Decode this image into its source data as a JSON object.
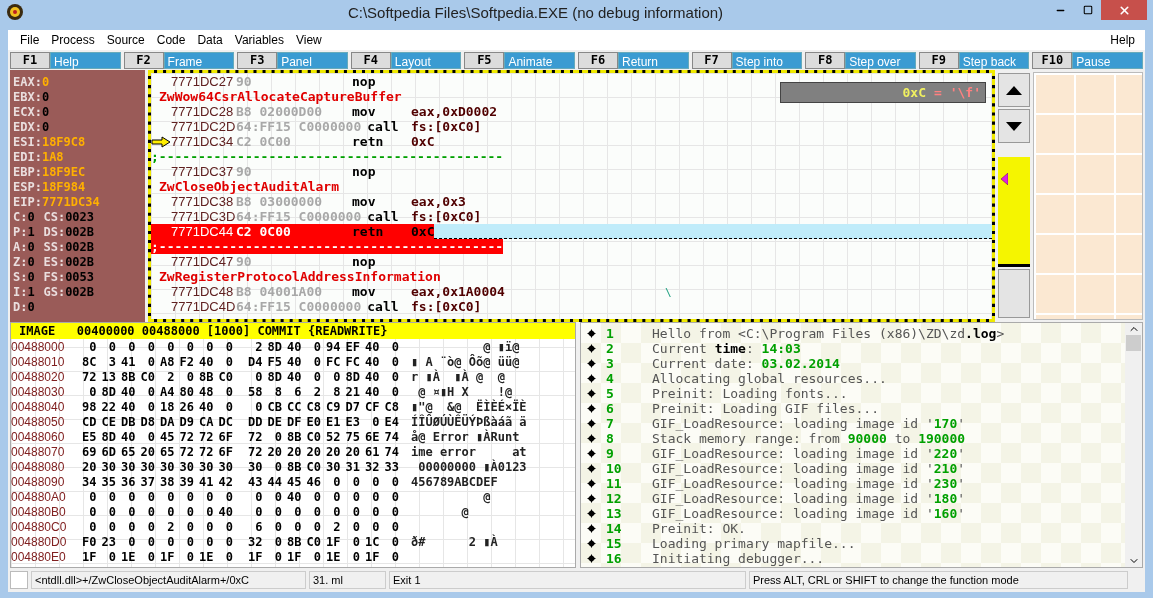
{
  "window": {
    "title": "C:\\Softpedia Files\\Softpedia.EXE (no debug information)"
  },
  "menu": {
    "items": [
      "File",
      "Process",
      "Source",
      "Code",
      "Data",
      "Variables",
      "View"
    ],
    "help": "Help"
  },
  "function_keys": [
    {
      "key": "F1",
      "action": "Help"
    },
    {
      "key": "F2",
      "action": "Frame"
    },
    {
      "key": "F3",
      "action": "Panel"
    },
    {
      "key": "F4",
      "action": "Layout"
    },
    {
      "key": "F5",
      "action": "Animate"
    },
    {
      "key": "F6",
      "action": "Return"
    },
    {
      "key": "F7",
      "action": "Step into"
    },
    {
      "key": "F8",
      "action": "Step over"
    },
    {
      "key": "F9",
      "action": "Step back"
    },
    {
      "key": "F10",
      "action": "Pause"
    }
  ],
  "registers": [
    {
      "name": "EAX:",
      "value": "0",
      "changed": true
    },
    {
      "name": "EBX:",
      "value": "0",
      "changed": false
    },
    {
      "name": "ECX:",
      "value": "0",
      "changed": false
    },
    {
      "name": "EDX:",
      "value": "0",
      "changed": false
    },
    {
      "name": "ESI:",
      "value": "18F9C8",
      "changed": true
    },
    {
      "name": "EDI:",
      "value": "1A8",
      "changed": true
    },
    {
      "name": "EBP:",
      "value": "18F9EC",
      "changed": true
    },
    {
      "name": "ESP:",
      "value": "18F984",
      "changed": true
    },
    {
      "name": "EIP:",
      "value": "7771DC34",
      "changed": true
    }
  ],
  "flags": [
    {
      "name": "C:",
      "value": "0"
    },
    {
      "name": "P:",
      "value": "1"
    },
    {
      "name": "A:",
      "value": "0"
    },
    {
      "name": "Z:",
      "value": "0"
    },
    {
      "name": "S:",
      "value": "0"
    },
    {
      "name": "I:",
      "value": "1"
    },
    {
      "name": "D:",
      "value": "0"
    }
  ],
  "segments": [
    {
      "name": "CS:",
      "value": "0023"
    },
    {
      "name": "DS:",
      "value": "002B"
    },
    {
      "name": "SS:",
      "value": "002B"
    },
    {
      "name": "ES:",
      "value": "002B"
    },
    {
      "name": "FS:",
      "value": "0053"
    },
    {
      "name": "GS:",
      "value": "002B"
    }
  ],
  "disassembly": {
    "tooltip": {
      "expr": "0xC",
      "value": "= '\\f'"
    },
    "marker": "\\",
    "rows": [
      {
        "kind": "instruction",
        "address": "7771DC27",
        "bytes": "90",
        "mnemonic": "nop",
        "current": false,
        "selected": false
      },
      {
        "kind": "label",
        "text": "ZwWow64CsrAllocateCaptureBuffer",
        "selected": false
      },
      {
        "kind": "instruction",
        "address": "7771DC28",
        "bytes": "B8 02000D00",
        "mnemonic": "mov",
        "operand": "eax,0xD0002",
        "current": false,
        "selected": false
      },
      {
        "kind": "instruction",
        "address": "7771DC2D",
        "bytes": "64:FF15 C0000000",
        "mnemonic": "call",
        "operand": "fs:[0xC0]",
        "current": false,
        "selected": false
      },
      {
        "kind": "instruction",
        "address": "7771DC34",
        "bytes": "C2 0C00",
        "mnemonic": "retn",
        "operand": "0xC",
        "current": true,
        "selected": false
      },
      {
        "kind": "separator",
        "text": ";--------------------------------------------",
        "selected": false
      },
      {
        "kind": "instruction",
        "address": "7771DC37",
        "bytes": "90",
        "mnemonic": "nop",
        "current": false,
        "selected": false
      },
      {
        "kind": "label",
        "text": "ZwCloseObjectAuditAlarm",
        "selected": false
      },
      {
        "kind": "instruction",
        "address": "7771DC38",
        "bytes": "B8 03000000",
        "mnemonic": "mov",
        "operand": "eax,0x3",
        "current": false,
        "selected": false
      },
      {
        "kind": "instruction",
        "address": "7771DC3D",
        "bytes": "64:FF15 C0000000",
        "mnemonic": "call",
        "operand": "fs:[0xC0]",
        "current": false,
        "selected": false
      },
      {
        "kind": "instruction",
        "address": "7771DC44",
        "bytes": "C2 0C00",
        "mnemonic": "retn",
        "operand": "0xC",
        "current": false,
        "selected": true
      },
      {
        "kind": "separator",
        "text": ";--------------------------------------------",
        "selected": true
      },
      {
        "kind": "instruction",
        "address": "7771DC47",
        "bytes": "90",
        "mnemonic": "nop",
        "current": false,
        "selected": false
      },
      {
        "kind": "label",
        "text": "ZwRegisterProtocolAddressInformation",
        "selected": false
      },
      {
        "kind": "instruction",
        "address": "7771DC48",
        "bytes": "B8 04001A00",
        "mnemonic": "mov",
        "operand": "eax,0x1A0004",
        "current": false,
        "selected": false
      },
      {
        "kind": "instruction",
        "address": "7771DC4D",
        "bytes": "64:FF15 C0000000",
        "mnemonic": "call",
        "operand": "fs:[0xC0]",
        "current": false,
        "selected": false
      }
    ]
  },
  "memory": {
    "header": "IMAGE   00400000 00488000 [1000] COMMIT {READWRITE}",
    "rows": [
      {
        "address": "00488000",
        "bytes": [
          "0",
          "0",
          "0",
          "0",
          "0",
          "0",
          "0",
          "0",
          "2",
          "8D",
          "40",
          "0",
          "94",
          "EF",
          "40",
          "0"
        ],
        "ascii": "          @ ▮ï@"
      },
      {
        "address": "00488010",
        "bytes": [
          "8C",
          "3",
          "41",
          "0",
          "A8",
          "F2",
          "40",
          "0",
          "D4",
          "F5",
          "40",
          "0",
          "FC",
          "FC",
          "40",
          "0"
        ],
        "ascii": "▮ A ¨ò@ Ôõ@ üü@"
      },
      {
        "address": "00488020",
        "bytes": [
          "72",
          "13",
          "8B",
          "C0",
          "2",
          "0",
          "8B",
          "C0",
          "0",
          "8D",
          "40",
          "0",
          "0",
          "8D",
          "40",
          "0"
        ],
        "ascii": "r ▮À  ▮À @  @"
      },
      {
        "address": "00488030",
        "bytes": [
          "0",
          "8D",
          "40",
          "0",
          "A4",
          "80",
          "48",
          "0",
          "58",
          "8",
          "6",
          "2",
          "8",
          "21",
          "40",
          "0"
        ],
        "ascii": " @ ¤▮H X    !@"
      },
      {
        "address": "00488040",
        "bytes": [
          "98",
          "22",
          "40",
          "0",
          "18",
          "26",
          "40",
          "0",
          "0",
          "CB",
          "CC",
          "C8",
          "C9",
          "D7",
          "CF",
          "C8"
        ],
        "ascii": "▮\"@  &@  ËÌÈÉ×ÏÈ"
      },
      {
        "address": "00488050",
        "bytes": [
          "CD",
          "CE",
          "DB",
          "D8",
          "DA",
          "D9",
          "CA",
          "DC",
          "DD",
          "DE",
          "DF",
          "E0",
          "E1",
          "E3",
          "0",
          "E4"
        ],
        "ascii": "ÍÎÛØÚÙÊÜÝÞßàáã ä"
      },
      {
        "address": "00488060",
        "bytes": [
          "E5",
          "8D",
          "40",
          "0",
          "45",
          "72",
          "72",
          "6F",
          "72",
          "0",
          "8B",
          "C0",
          "52",
          "75",
          "6E",
          "74"
        ],
        "ascii": "å@ Error ▮ÀRunt"
      },
      {
        "address": "00488070",
        "bytes": [
          "69",
          "6D",
          "65",
          "20",
          "65",
          "72",
          "72",
          "6F",
          "72",
          "20",
          "20",
          "20",
          "20",
          "20",
          "61",
          "74"
        ],
        "ascii": "ime error     at"
      },
      {
        "address": "00488080",
        "bytes": [
          "20",
          "30",
          "30",
          "30",
          "30",
          "30",
          "30",
          "30",
          "30",
          "0",
          "8B",
          "C0",
          "30",
          "31",
          "32",
          "33"
        ],
        "ascii": " 00000000 ▮À0123"
      },
      {
        "address": "00488090",
        "bytes": [
          "34",
          "35",
          "36",
          "37",
          "38",
          "39",
          "41",
          "42",
          "43",
          "44",
          "45",
          "46",
          "0",
          "0",
          "0",
          "0"
        ],
        "ascii": "456789ABCDEF"
      },
      {
        "address": "004880A0",
        "bytes": [
          "0",
          "0",
          "0",
          "0",
          "0",
          "0",
          "0",
          "0",
          "0",
          "0",
          "40",
          "0",
          "0",
          "0",
          "0",
          "0"
        ],
        "ascii": "          @"
      },
      {
        "address": "004880B0",
        "bytes": [
          "0",
          "0",
          "0",
          "0",
          "0",
          "0",
          "0",
          "40",
          "0",
          "0",
          "0",
          "0",
          "0",
          "0",
          "0",
          "0"
        ],
        "ascii": "       @"
      },
      {
        "address": "004880C0",
        "bytes": [
          "0",
          "0",
          "0",
          "0",
          "2",
          "0",
          "0",
          "0",
          "6",
          "0",
          "0",
          "0",
          "2",
          "0",
          "0",
          "0"
        ]
      },
      {
        "address": "004880D0",
        "bytes": [
          "F0",
          "23",
          "0",
          "0",
          "0",
          "0",
          "0",
          "0",
          "32",
          "0",
          "8B",
          "C0",
          "1F",
          "0",
          "1C",
          "0"
        ],
        "ascii": "ð#      2 ▮À"
      },
      {
        "address": "004880E0",
        "bytes": [
          "1F",
          "0",
          "1E",
          "0",
          "1F",
          "0",
          "1E",
          "0",
          "1F",
          "0",
          "1F",
          "0",
          "1E",
          "0",
          "1F",
          "0"
        ]
      }
    ]
  },
  "log": [
    {
      "number": "1",
      "parts": [
        {
          "kind": "plain",
          "text": "Hello from <C:\\Program Files (x86)\\ZD\\zd"
        },
        {
          "kind": "strong",
          "text": ".log"
        },
        {
          "kind": "plain",
          "text": ">"
        }
      ]
    },
    {
      "number": "2",
      "parts": [
        {
          "kind": "plain",
          "text": "Current "
        },
        {
          "kind": "strong",
          "text": "time"
        },
        {
          "kind": "plain",
          "text": ": "
        },
        {
          "kind": "value",
          "text": "14:03"
        }
      ]
    },
    {
      "number": "3",
      "parts": [
        {
          "kind": "plain",
          "text": "Current date: "
        },
        {
          "kind": "value",
          "text": "03.02.2014"
        }
      ]
    },
    {
      "number": "4",
      "parts": [
        {
          "kind": "plain",
          "text": "Allocating global resources..."
        }
      ]
    },
    {
      "number": "5",
      "parts": [
        {
          "kind": "plain",
          "text": "Preinit: Loading fonts..."
        }
      ]
    },
    {
      "number": "6",
      "parts": [
        {
          "kind": "plain",
          "text": "Preinit: Loading GIF files..."
        }
      ]
    },
    {
      "number": "7",
      "parts": [
        {
          "kind": "plain",
          "text": "GIF_LoadResource: loading image id '"
        },
        {
          "kind": "value",
          "text": "170"
        },
        {
          "kind": "plain",
          "text": "'"
        }
      ]
    },
    {
      "number": "8",
      "parts": [
        {
          "kind": "plain",
          "text": "Stack memory range: from "
        },
        {
          "kind": "value",
          "text": "90000"
        },
        {
          "kind": "plain",
          "text": " to "
        },
        {
          "kind": "value",
          "text": "190000"
        }
      ]
    },
    {
      "number": "9",
      "parts": [
        {
          "kind": "plain",
          "text": "GIF_LoadResource: loading image id '"
        },
        {
          "kind": "value",
          "text": "220"
        },
        {
          "kind": "plain",
          "text": "'"
        }
      ]
    },
    {
      "number": "10",
      "parts": [
        {
          "kind": "plain",
          "text": "GIF_LoadResource: loading image id '"
        },
        {
          "kind": "value",
          "text": "210"
        },
        {
          "kind": "plain",
          "text": "'"
        }
      ]
    },
    {
      "number": "11",
      "parts": [
        {
          "kind": "plain",
          "text": "GIF_LoadResource: loading image id '"
        },
        {
          "kind": "value",
          "text": "230"
        },
        {
          "kind": "plain",
          "text": "'"
        }
      ]
    },
    {
      "number": "12",
      "parts": [
        {
          "kind": "plain",
          "text": "GIF_LoadResource: loading image id '"
        },
        {
          "kind": "value",
          "text": "180"
        },
        {
          "kind": "plain",
          "text": "'"
        }
      ]
    },
    {
      "number": "13",
      "parts": [
        {
          "kind": "plain",
          "text": "GIF_LoadResource: loading image id '"
        },
        {
          "kind": "value",
          "text": "160"
        },
        {
          "kind": "plain",
          "text": "'"
        }
      ]
    },
    {
      "number": "14",
      "parts": [
        {
          "kind": "plain",
          "text": "Preinit: OK."
        }
      ]
    },
    {
      "number": "15",
      "parts": [
        {
          "kind": "plain",
          "text": "Loading primary mapfile..."
        }
      ]
    },
    {
      "number": "16",
      "parts": [
        {
          "kind": "plain",
          "text": "Initiating debugger..."
        }
      ]
    }
  ],
  "status_bar": [
    "<ntdll.dll>+/ZwCloseObjectAuditAlarm+/0xC",
    "31. ml",
    "Exit 1",
    "Press ALT, CRL or SHIFT to change the function mode"
  ]
}
